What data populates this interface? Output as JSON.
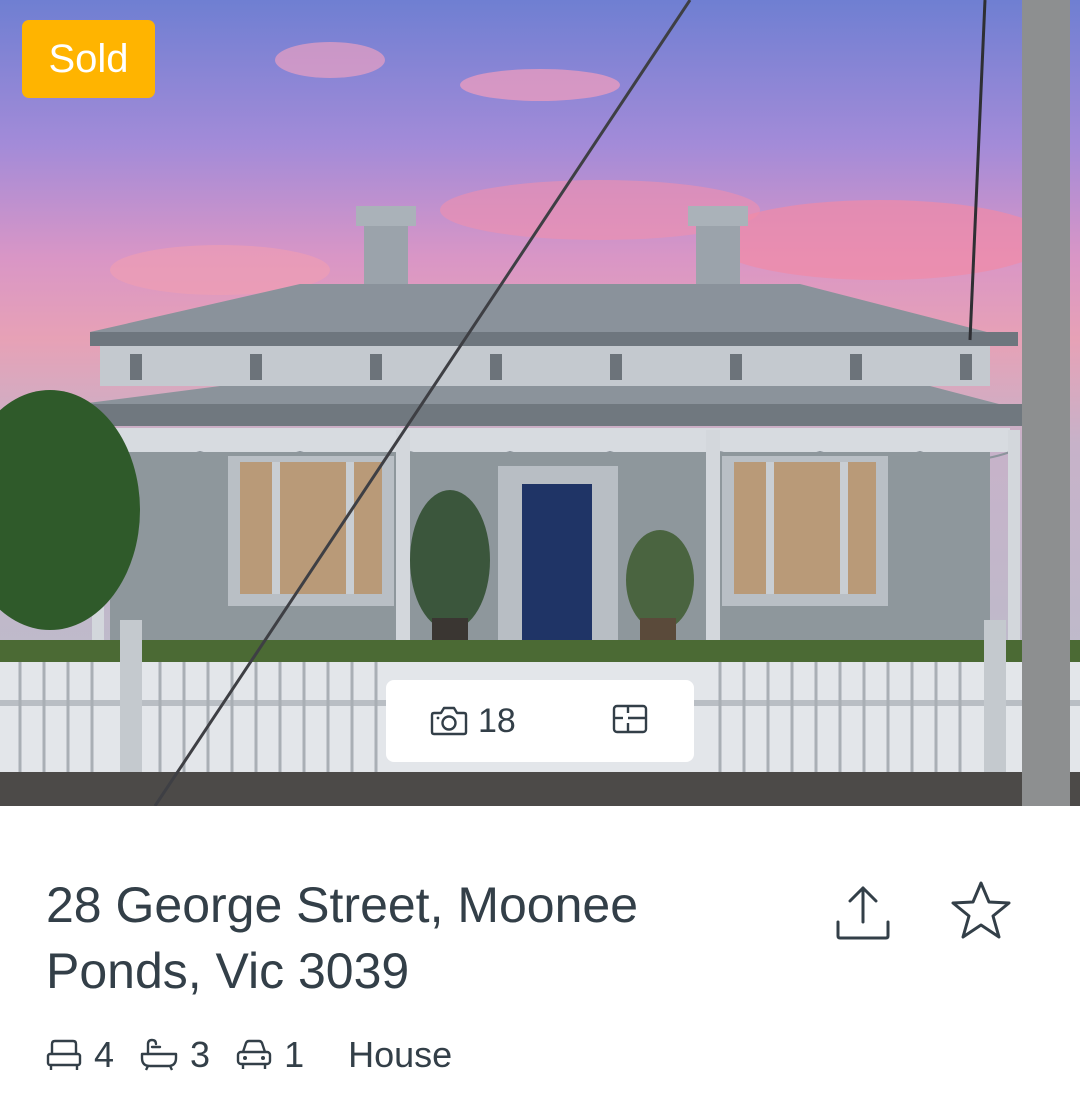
{
  "listing": {
    "status_badge": "Sold",
    "photo_count": "18",
    "address_line": "28 George Street, Moonee Ponds, Vic 3039",
    "features": {
      "bedrooms": "4",
      "bathrooms": "3",
      "car_spaces": "1",
      "property_type": "House"
    }
  },
  "icons": {
    "photos": "camera-icon",
    "floorplan": "floorplan-icon",
    "share": "share-icon",
    "shortlist": "star-icon",
    "bed": "bed-icon",
    "bath": "bath-icon",
    "car": "car-icon"
  },
  "colors": {
    "sold_badge": "#ffb400",
    "text": "#333f48",
    "background": "#ffffff"
  }
}
